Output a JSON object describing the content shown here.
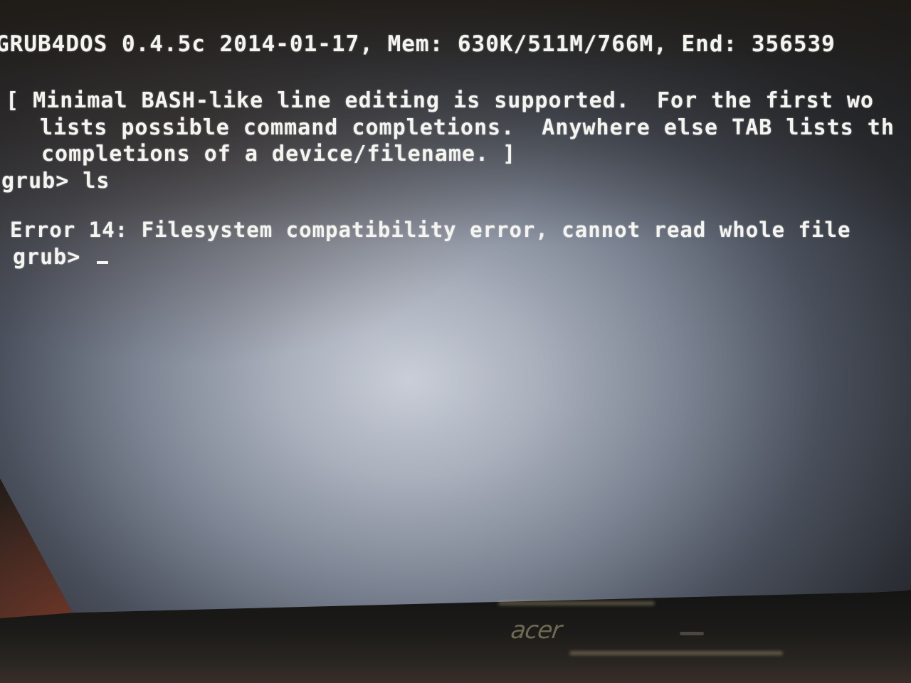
{
  "screen": {
    "header": "GRUB4DOS 0.4.5c 2014-01-17, Mem: 630K/511M/766M, End: 356539",
    "info_lines": [
      "[ Minimal BASH-like line editing is supported.  For the first wo",
      "lists possible command completions.  Anywhere else TAB lists th",
      "completions of a device/filename. ]"
    ],
    "command1": {
      "prompt": "grub>",
      "input": "ls"
    },
    "error": "Error 14: Filesystem compatibility error, cannot read whole file",
    "command2": {
      "prompt": "grub>",
      "input": ""
    }
  },
  "bezel": {
    "brand_logo": "acer"
  }
}
